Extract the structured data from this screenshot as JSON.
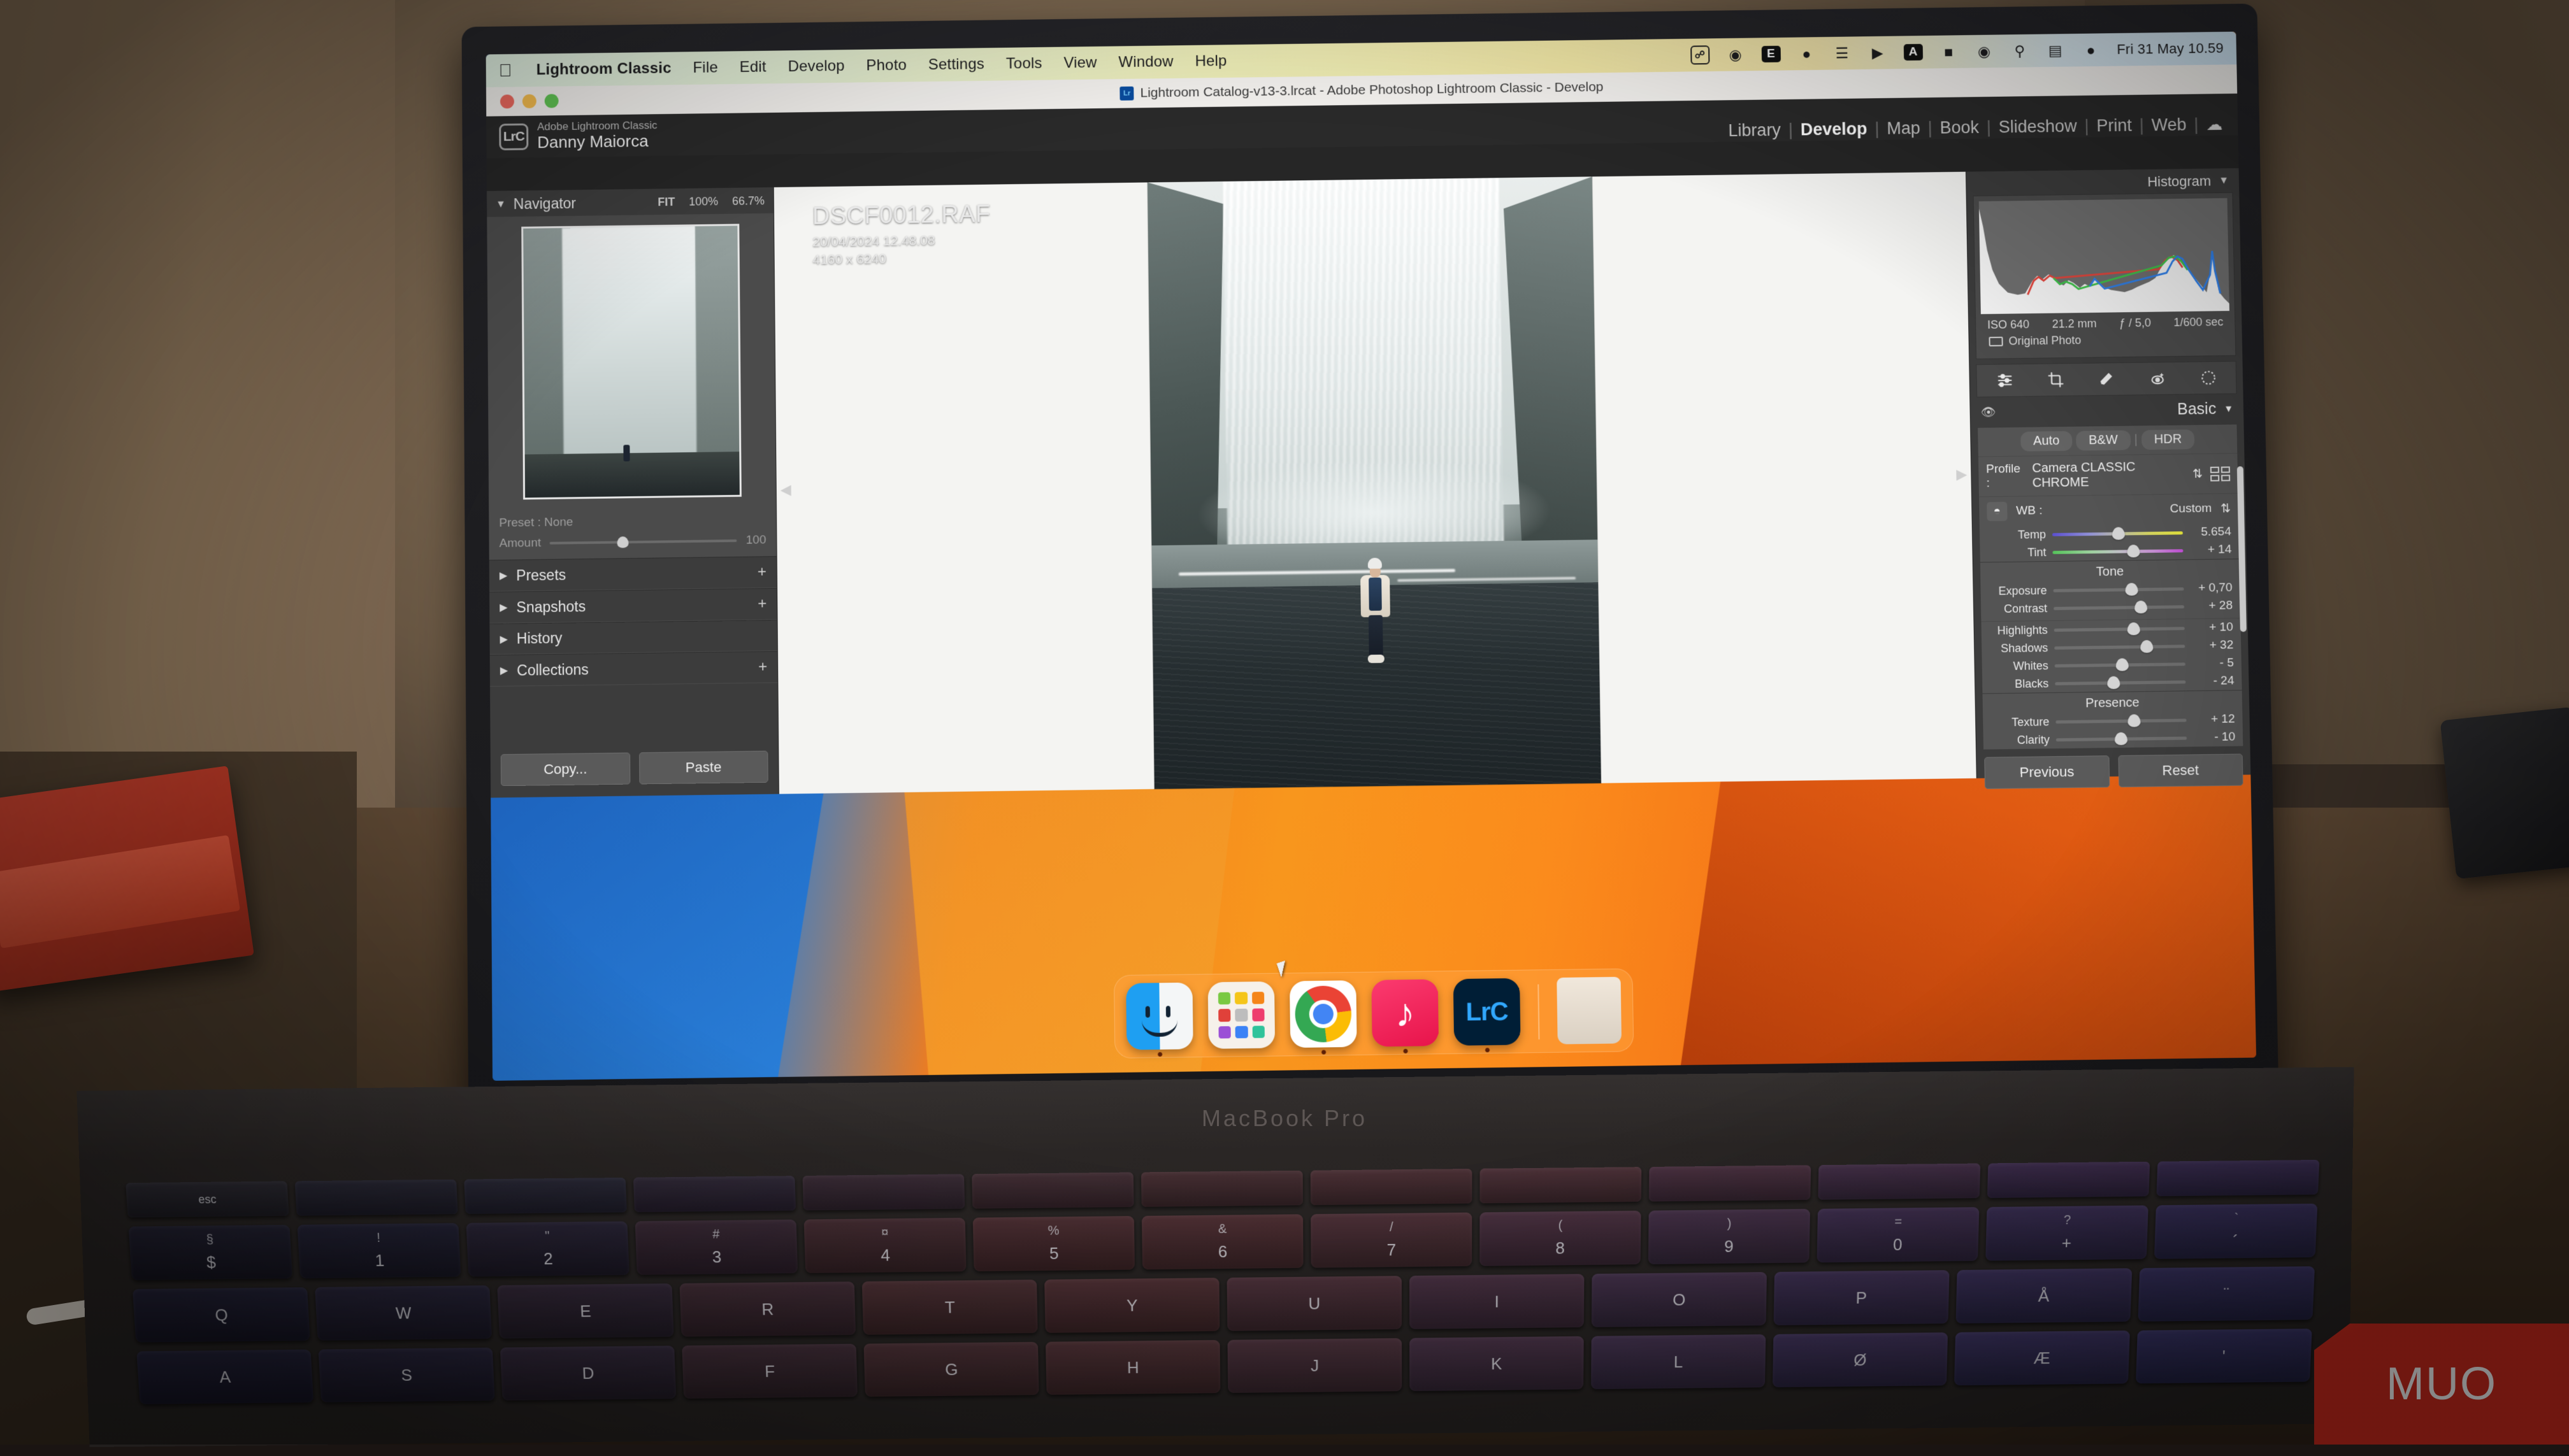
{
  "menubar": {
    "apple_icon": "apple-icon",
    "app_name": "Lightroom Classic",
    "menus": [
      "File",
      "Edit",
      "Develop",
      "Photo",
      "Settings",
      "Tools",
      "View",
      "Window",
      "Help"
    ],
    "status_icons": [
      "shield-icon",
      "k-circle-icon",
      "box-x-icon",
      "record-circle-icon",
      "stack-icon",
      "play-circle-icon",
      "a-badge-icon",
      "battery-icon",
      "wifi-icon",
      "search-icon",
      "control-center-icon",
      "siri-icon"
    ],
    "clock": "Fri 31 May  10.59"
  },
  "window": {
    "title": "Lightroom Catalog-v13-3.lrcat - Adobe Photoshop Lightroom Classic - Develop",
    "app_icon": "lightroom-classic-icon",
    "traffic_lights": [
      "close-button",
      "minimize-button",
      "zoom-button"
    ]
  },
  "identity": {
    "badge": "LrC",
    "line1": "Adobe Lightroom Classic",
    "line2": "Danny Maiorca"
  },
  "modules": {
    "items": [
      "Library",
      "Develop",
      "Map",
      "Book",
      "Slideshow",
      "Print",
      "Web"
    ],
    "active": "Develop",
    "cloud_icon": "cloud-icon"
  },
  "left_panel": {
    "navigator": {
      "title": "Navigator",
      "zoom_fit": "FIT",
      "zoom_100": "100%",
      "zoom_667": "66.7%"
    },
    "preset": {
      "label": "Preset :",
      "value": "None",
      "amount_label": "Amount",
      "amount_value": "100"
    },
    "sections": [
      {
        "label": "Presets",
        "has_plus": true
      },
      {
        "label": "Snapshots",
        "has_plus": true
      },
      {
        "label": "History",
        "has_plus": false
      },
      {
        "label": "Collections",
        "has_plus": true
      }
    ],
    "copy_label": "Copy...",
    "paste_label": "Paste"
  },
  "photo": {
    "filename": "DSCF0012.RAF",
    "datetime": "20/04/2024 12.48.08",
    "dimensions": "4160 x 6240"
  },
  "right_panel": {
    "histogram": {
      "title": "Histogram",
      "iso": "ISO 640",
      "focal": "21.2 mm",
      "aperture": "ƒ / 5,0",
      "shutter": "1/600 sec",
      "original_photo": "Original Photo"
    },
    "tools": [
      "masking-icon",
      "crop-icon",
      "healing-brush-icon",
      "red-eye-icon",
      "radial-gradient-icon"
    ],
    "basic": {
      "title": "Basic",
      "eye_icon": "eye-icon",
      "treatments": [
        "Auto",
        "B&W",
        "HDR"
      ],
      "profile_label": "Profile :",
      "profile_value": "Camera CLASSIC CHROME",
      "wb_label": "WB :",
      "wb_value": "Custom",
      "eyedropper_icon": "eyedropper-icon",
      "white_balance": [
        {
          "label": "Temp",
          "value": "5.654",
          "pos": 46
        },
        {
          "label": "Tint",
          "value": "+ 14",
          "pos": 57
        }
      ],
      "tone_header": "Tone",
      "tone": [
        {
          "label": "Exposure",
          "value": "+ 0,70",
          "pos": 55
        },
        {
          "label": "Contrast",
          "value": "+ 28",
          "pos": 62
        },
        {
          "label": "Highlights",
          "value": "+ 10",
          "pos": 56
        },
        {
          "label": "Shadows",
          "value": "+ 32",
          "pos": 66
        },
        {
          "label": "Whites",
          "value": "- 5",
          "pos": 47
        },
        {
          "label": "Blacks",
          "value": "- 24",
          "pos": 40
        }
      ],
      "presence_header": "Presence",
      "presence": [
        {
          "label": "Texture",
          "value": "+ 12",
          "pos": 55
        },
        {
          "label": "Clarity",
          "value": "- 10",
          "pos": 45
        }
      ]
    },
    "previous_label": "Previous",
    "reset_label": "Reset"
  },
  "dock": {
    "apps": [
      {
        "name": "finder-icon",
        "label": "Finder",
        "running": true
      },
      {
        "name": "launchpad-icon",
        "label": "Launchpad",
        "running": false
      },
      {
        "name": "chrome-icon",
        "label": "Google Chrome",
        "running": true
      },
      {
        "name": "music-icon",
        "label": "Music",
        "running": true
      },
      {
        "name": "lightroom-classic-icon",
        "label": "LrC",
        "running": true
      }
    ],
    "trash_label": "Trash"
  },
  "hardware": {
    "model_label": "MacBook Pro",
    "keyboard_fn_keys": [
      "esc",
      "",
      "",
      "",
      "",
      "",
      "",
      "",
      "",
      "",
      "",
      "",
      ""
    ],
    "keyboard_number_row": [
      {
        "top": "§",
        "bot": "$"
      },
      {
        "top": "!",
        "bot": "1"
      },
      {
        "top": "\"",
        "bot": "2"
      },
      {
        "top": "#",
        "bot": "3"
      },
      {
        "top": "¤",
        "bot": "4"
      },
      {
        "top": "%",
        "bot": "5"
      },
      {
        "top": "&",
        "bot": "6"
      },
      {
        "top": "/",
        "bot": "7"
      },
      {
        "top": "(",
        "bot": "8"
      },
      {
        "top": ")",
        "bot": "9"
      },
      {
        "top": "=",
        "bot": "0"
      },
      {
        "top": "?",
        "bot": "+"
      },
      {
        "top": "`",
        "bot": "´"
      }
    ],
    "keyboard_qwerty_row": [
      "Q",
      "W",
      "E",
      "R",
      "T",
      "Y",
      "U",
      "I",
      "O",
      "P",
      "Å",
      "¨"
    ],
    "keyboard_asdf_row": [
      "A",
      "S",
      "D",
      "F",
      "G",
      "H",
      "J",
      "K",
      "L",
      "Ø",
      "Æ",
      "'"
    ]
  },
  "watermark": {
    "text": "MUO"
  },
  "colors": {
    "accent_orange": "#f2801c",
    "accent_blue": "#1657a8",
    "lr_panel": "#3c3c3c",
    "lr_block": "#545454",
    "lrc_badge": "#31a8ff",
    "muo_red": "#c0281c"
  }
}
